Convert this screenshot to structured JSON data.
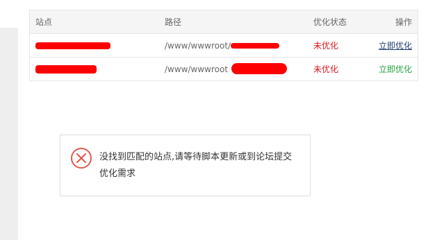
{
  "table": {
    "headers": {
      "site": "站点",
      "path": "路径",
      "status": "优化状态",
      "action": "操作"
    },
    "rows": [
      {
        "site": "",
        "path": "/www/wwwroot/",
        "status": "未优化",
        "action": "立即优化"
      },
      {
        "site": "",
        "path": "/www/wwwroot",
        "status": "未优化",
        "action": "立即优化"
      }
    ]
  },
  "dialog": {
    "icon": "error-x-icon",
    "message": "没找到匹配的站点,请等待脚本更新或到论坛提交优化需求"
  },
  "colors": {
    "error_red": "#e0151f",
    "link_blue": "#1d3d70",
    "success_green": "#20a53a",
    "redaction_red": "#ff0000",
    "header_bg": "#f5f5f5",
    "side_panel_bg": "#eeeeee"
  }
}
